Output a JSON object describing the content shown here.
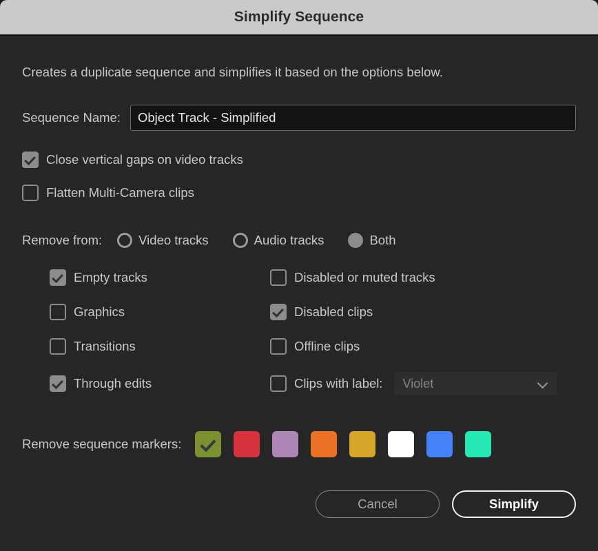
{
  "window": {
    "title": "Simplify Sequence"
  },
  "intro": "Creates a duplicate sequence and simplifies it based on the options below.",
  "sequence_name": {
    "label": "Sequence Name:",
    "value": "Object Track - Simplified",
    "placeholder": "Sequence Name"
  },
  "top_options": [
    {
      "label": "Close vertical gaps on video tracks",
      "checked": true
    },
    {
      "label": "Flatten Multi-Camera clips",
      "checked": false
    }
  ],
  "remove_from": {
    "label": "Remove from:",
    "options": [
      {
        "label": "Video tracks",
        "selected": false
      },
      {
        "label": "Audio tracks",
        "selected": false
      },
      {
        "label": "Both",
        "selected": true
      }
    ]
  },
  "remove_options": {
    "left": [
      {
        "label": "Empty tracks",
        "checked": true
      },
      {
        "label": "Graphics",
        "checked": false
      },
      {
        "label": "Transitions",
        "checked": false
      },
      {
        "label": "Through edits",
        "checked": true
      }
    ],
    "right": [
      {
        "label": "Disabled or muted tracks",
        "checked": false
      },
      {
        "label": "Disabled clips",
        "checked": true
      },
      {
        "label": "Offline clips",
        "checked": false
      },
      {
        "label": "Clips with label:",
        "checked": false
      }
    ]
  },
  "label_select": {
    "value": "Violet",
    "icon": "chevron-down-icon",
    "enabled": false
  },
  "markers": {
    "label": "Remove sequence markers:",
    "swatches": [
      {
        "name": "green",
        "color": "#7b9130",
        "checked": true
      },
      {
        "name": "red",
        "color": "#d6333f",
        "checked": false
      },
      {
        "name": "violet",
        "color": "#ae86b5",
        "checked": false
      },
      {
        "name": "orange",
        "color": "#ea7125",
        "checked": false
      },
      {
        "name": "yellow",
        "color": "#d6a72a",
        "checked": false
      },
      {
        "name": "white",
        "color": "#ffffff",
        "checked": false
      },
      {
        "name": "blue",
        "color": "#4482f7",
        "checked": false
      },
      {
        "name": "teal",
        "color": "#25e8b4",
        "checked": false
      }
    ]
  },
  "footer": {
    "cancel_label": "Cancel",
    "confirm_label": "Simplify"
  }
}
